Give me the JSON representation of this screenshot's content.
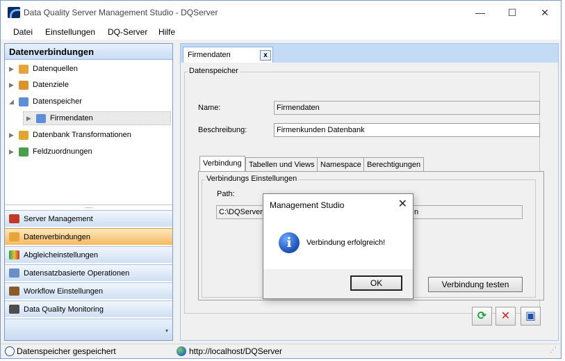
{
  "window": {
    "title": "Data Quality Server Management Studio - DQServer",
    "minimize": "—",
    "maximize": "☐",
    "close": "✕"
  },
  "menu": [
    "Datei",
    "Einstellungen",
    "DQ-Server",
    "Hilfe"
  ],
  "left_panel": {
    "header": "Datenverbindungen",
    "tree": [
      {
        "label": "Datenquellen",
        "arrow": "▶",
        "icon_color": "#e8a43a"
      },
      {
        "label": "Datenziele",
        "arrow": "▶",
        "icon_color": "#d9922e"
      },
      {
        "label": "Datenspeicher",
        "arrow": "◢",
        "icon_color": "#5d8ed6"
      },
      {
        "label": "Firmendaten",
        "arrow": "▶",
        "icon_color": "#5d8ed6"
      },
      {
        "label": "Datenbank Transformationen",
        "arrow": "▶",
        "icon_color": "#e0a72f"
      },
      {
        "label": "Feldzuordnungen",
        "arrow": "▶",
        "icon_color": "#4aa04a"
      }
    ],
    "splitter": ".....",
    "nav": [
      {
        "label": "Server Management",
        "icon_color": "#c0392b"
      },
      {
        "label": "Datenverbindungen",
        "icon_color": "#e8a43a"
      },
      {
        "label": "Abgleicheinstellungen",
        "icon_color": "#2e9e48"
      },
      {
        "label": "Datensatzbasierte Operationen",
        "icon_color": "#6a8fc4"
      },
      {
        "label": "Workflow Einstellungen",
        "icon_color": "#8a5a2b"
      },
      {
        "label": "Data Quality Monitoring",
        "icon_color": "#4d4d4d"
      }
    ],
    "footer_chevron": "▾"
  },
  "document": {
    "tab_label": "Firmendaten",
    "tab_close": "x",
    "group_title": "Datenspeicher",
    "name_label": "Name:",
    "name_value": "Firmendaten",
    "description_label": "Beschreibung:",
    "description_value": "Firmenkunden Datenbank",
    "inner_tabs": [
      "Verbindung",
      "Tabellen und Views",
      "Namespace",
      "Berechtigungen"
    ],
    "connection_group_title": "Verbindungs Einstellungen",
    "path_label": "Path:",
    "path_value_visible_left": "C:\\DQServerD",
    "path_value_visible_right": "n",
    "test_button": "Verbindung testen",
    "refresh_glyph": "⟳",
    "cancel_glyph": "✕",
    "save_glyph": "▣"
  },
  "dialog": {
    "title": "Management Studio",
    "close": "✕",
    "icon_glyph": "i",
    "message": "Verbindung erfolgreich!",
    "ok_button": "OK"
  },
  "statusbar": {
    "message": "Datenspeicher gespeichert",
    "url": "http://localhost/DQServer",
    "grip": "⋰"
  }
}
